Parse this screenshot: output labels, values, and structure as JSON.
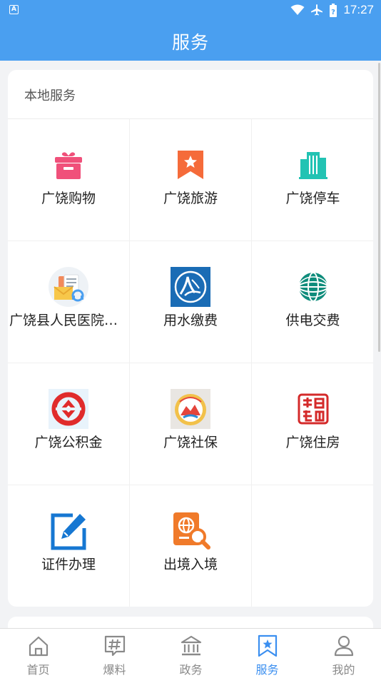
{
  "status_bar": {
    "left_icon": "A",
    "time": "17:27",
    "icons": [
      "wifi-icon",
      "airplane-icon",
      "battery-icon"
    ]
  },
  "header": {
    "title": "服务"
  },
  "local_services": {
    "title": "本地服务",
    "items": [
      {
        "label": "广饶购物",
        "icon": "gift-icon",
        "color": "#f0507a"
      },
      {
        "label": "广饶旅游",
        "icon": "bookmark-star-icon",
        "color": "#f56b3a"
      },
      {
        "label": "广饶停车",
        "icon": "building-icon",
        "color": "#22c3b3"
      },
      {
        "label": "广饶县人民医院挂…",
        "icon": "hospital-registration-icon",
        "color": "#f2a33a"
      },
      {
        "label": "用水缴费",
        "icon": "water-logo-icon",
        "color": "#1a6cb5"
      },
      {
        "label": "供电交费",
        "icon": "state-grid-logo-icon",
        "color": "#0e8c7b"
      },
      {
        "label": "广饶公积金",
        "icon": "housing-fund-logo-icon",
        "color": "#e02b2b"
      },
      {
        "label": "广饶社保",
        "icon": "social-security-logo-icon",
        "color": "#e4443b"
      },
      {
        "label": "广饶住房",
        "icon": "housing-seal-icon",
        "color": "#d42a2a"
      },
      {
        "label": "证件办理",
        "icon": "edit-document-icon",
        "color": "#1677d2"
      },
      {
        "label": "出境入境",
        "icon": "passport-search-icon",
        "color": "#f07a2a"
      }
    ]
  },
  "tabbar": {
    "active": "服务",
    "active_color": "#3b8ff0",
    "tabs": [
      {
        "label": "首页",
        "icon": "home-icon"
      },
      {
        "label": "爆料",
        "icon": "hashtag-chat-icon"
      },
      {
        "label": "政务",
        "icon": "government-building-icon"
      },
      {
        "label": "服务",
        "icon": "service-star-icon"
      },
      {
        "label": "我的",
        "icon": "user-icon"
      }
    ]
  },
  "colors": {
    "primary": "#4a9ff0",
    "background": "#f2f3f5"
  }
}
